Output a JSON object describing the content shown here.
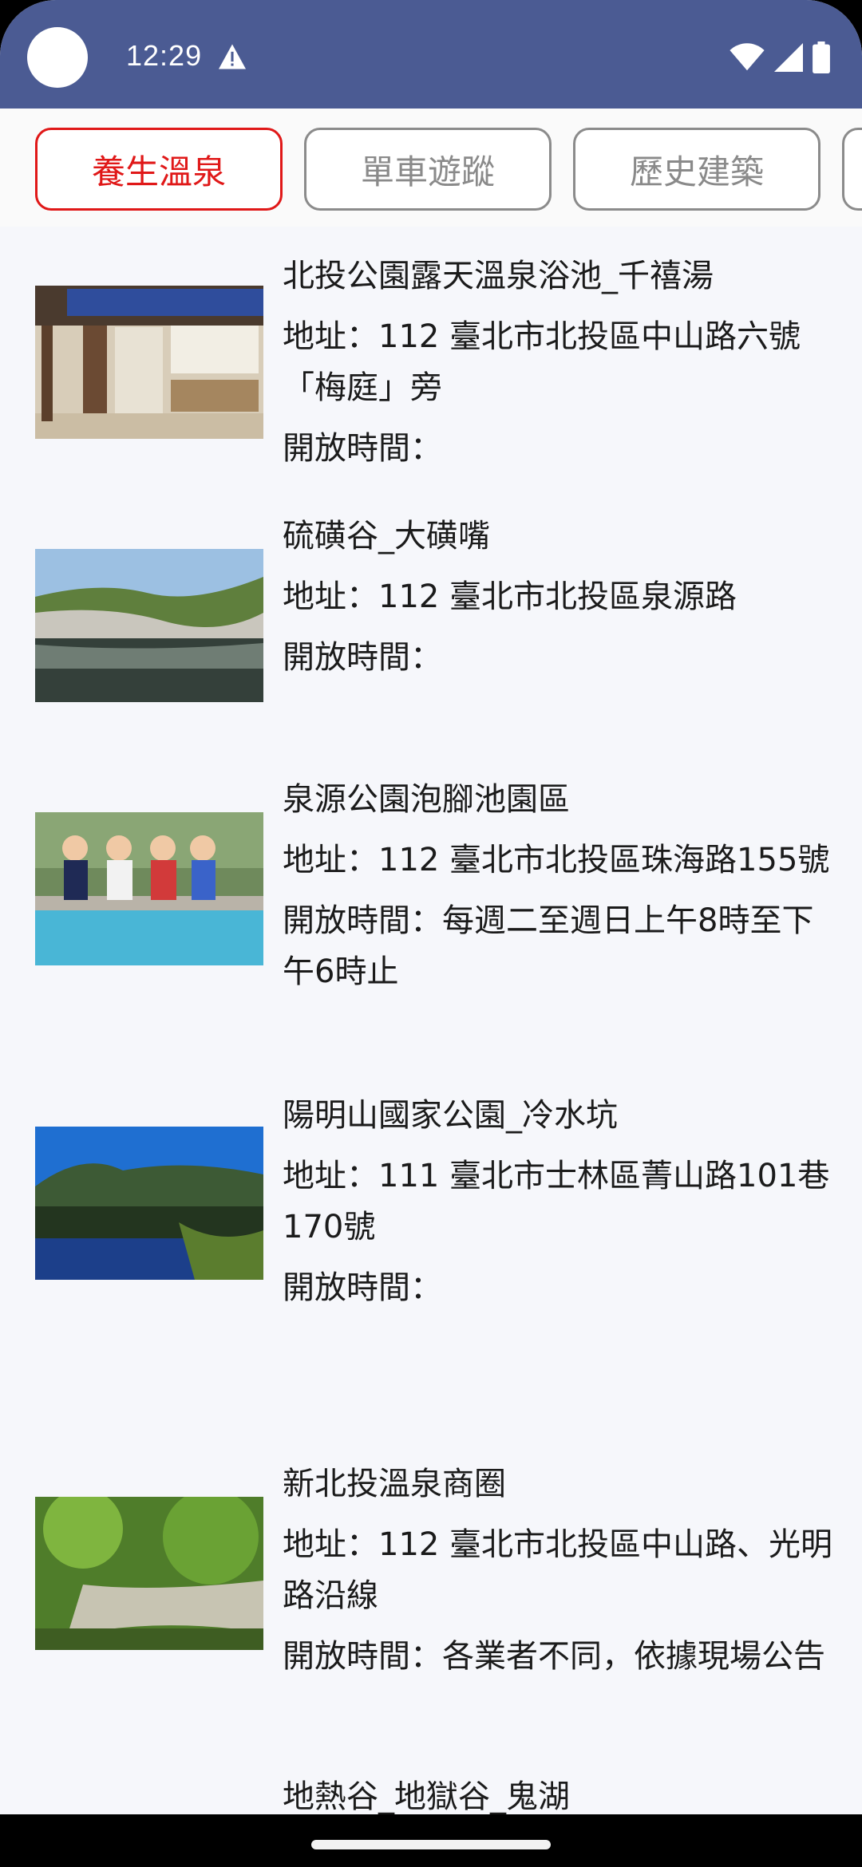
{
  "status": {
    "time": "12:29"
  },
  "tabs": [
    {
      "label": "養生溫泉",
      "active": true
    },
    {
      "label": "單車遊蹤",
      "active": false
    },
    {
      "label": "歷史建築",
      "active": false
    }
  ],
  "items": [
    {
      "title": "北投公園露天溫泉浴池_千禧湯",
      "address": "地址：112 臺北市北投區中山路六號「梅庭」旁",
      "hours": "開放時間：",
      "image": "outdoor-hot-spring-building"
    },
    {
      "title": "硫磺谷_大磺嘴",
      "address": "地址：112 臺北市北投區泉源路",
      "hours": "開放時間：",
      "image": "sulfur-valley-lake"
    },
    {
      "title": "泉源公園泡腳池園區",
      "address": "地址：112 臺北市北投區珠海路155號",
      "hours": "開放時間：每週二至週日上午8時至下午6時止",
      "image": "children-foot-bath"
    },
    {
      "title": "陽明山國家公園_冷水坑",
      "address": "地址：111 臺北市士林區菁山路101巷170號",
      "hours": "開放時間：",
      "image": "mountain-lake-reflection"
    },
    {
      "title": "新北投溫泉商圈",
      "address": "地址：112 臺北市北投區中山路、光明路沿線",
      "hours": "開放時間：各業者不同，依據現場公告",
      "image": "forest-stream"
    },
    {
      "title": "地熱谷_地獄谷_鬼湖",
      "address": "",
      "hours": "",
      "image": ""
    }
  ]
}
